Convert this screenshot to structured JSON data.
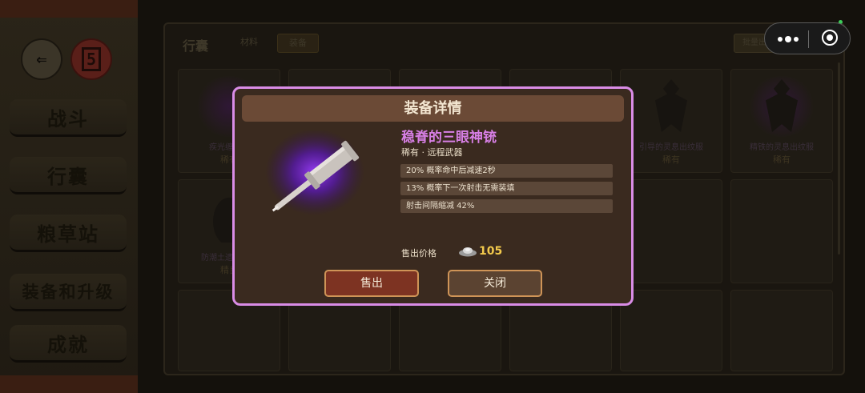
{
  "sidebar": {
    "back_icon_text": "⇐",
    "badge_text": "5",
    "items": [
      {
        "label": "战斗"
      },
      {
        "label": "行囊"
      },
      {
        "label": "粮草站"
      },
      {
        "label": "装备和升级"
      },
      {
        "label": "成就"
      }
    ]
  },
  "inventory": {
    "title": "行囊",
    "tabs": [
      {
        "label": "材料"
      },
      {
        "label": "装备"
      }
    ],
    "batch_button": "批量出售",
    "cells": [
      {
        "name": "疾光缠流的",
        "rarity": "稀有"
      },
      {
        "name": "",
        "rarity": ""
      },
      {
        "name": "",
        "rarity": ""
      },
      {
        "name": "",
        "rarity": ""
      },
      {
        "name": "引导的灵息出纹服",
        "rarity": "稀有"
      },
      {
        "name": "精铁的灵息出纹服",
        "rarity": "稀有"
      },
      {
        "name": "防潮土遗的布面",
        "rarity": "精良"
      }
    ]
  },
  "modal": {
    "title": "装备详情",
    "item_name": "稳脊的三眼神铳",
    "item_type": "稀有 · 远程武器",
    "attributes": [
      "20% 概率命中后减速2秒",
      "13% 概率下一次射击无需装填",
      "射击间隔缩减 42%"
    ],
    "price_label": "售出价格",
    "price_value": "105",
    "sell_button": "售出",
    "close_button": "关闭"
  },
  "colors": {
    "modal_border": "#d98ce6",
    "item_name": "#d77fe5",
    "price": "#f2c94c",
    "sell_button": "#7d3322"
  },
  "icons": [
    "back-arrow-icon",
    "badge-icon",
    "more-dots-icon",
    "record-target-icon",
    "silver-ingot-icon",
    "firearm-icon"
  ]
}
